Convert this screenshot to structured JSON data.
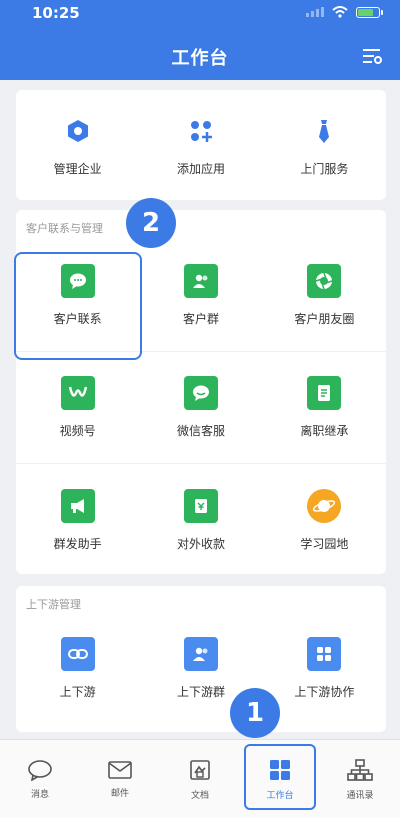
{
  "status": {
    "time": "10:25"
  },
  "header": {
    "title": "工作台"
  },
  "top_grid": [
    {
      "label": "管理企业",
      "icon": "hexagon-settings-icon"
    },
    {
      "label": "添加应用",
      "icon": "add-apps-icon"
    },
    {
      "label": "上门服务",
      "icon": "tie-icon"
    }
  ],
  "customer_section": {
    "title": "客户联系与管理",
    "items": [
      {
        "label": "客户联系",
        "icon": "chat-bubble-icon"
      },
      {
        "label": "客户群",
        "icon": "customer-group-icon"
      },
      {
        "label": "客户朋友圈",
        "icon": "moments-icon"
      },
      {
        "label": "视频号",
        "icon": "channels-icon"
      },
      {
        "label": "微信客服",
        "icon": "service-chat-icon"
      },
      {
        "label": "离职继承",
        "icon": "document-icon"
      },
      {
        "label": "群发助手",
        "icon": "megaphone-icon"
      },
      {
        "label": "对外收款",
        "icon": "payment-icon"
      },
      {
        "label": "学习园地",
        "icon": "planet-icon"
      }
    ]
  },
  "upstream_section": {
    "title": "上下游管理",
    "items": [
      {
        "label": "上下游",
        "icon": "link-icon"
      },
      {
        "label": "上下游群",
        "icon": "group-icon"
      },
      {
        "label": "上下游协作",
        "icon": "grid-apps-icon"
      }
    ]
  },
  "annotations": {
    "step1": "1",
    "step2": "2"
  },
  "tabbar": [
    {
      "label": "消息",
      "icon": "message-icon"
    },
    {
      "label": "邮件",
      "icon": "mail-icon"
    },
    {
      "label": "文档",
      "icon": "docs-icon"
    },
    {
      "label": "工作台",
      "icon": "workbench-icon"
    },
    {
      "label": "通讯录",
      "icon": "contacts-icon"
    }
  ],
  "colors": {
    "accent": "#3c7be6",
    "green": "#2db35a",
    "blue_icon": "#4a8bf0",
    "orange": "#f5a623"
  }
}
